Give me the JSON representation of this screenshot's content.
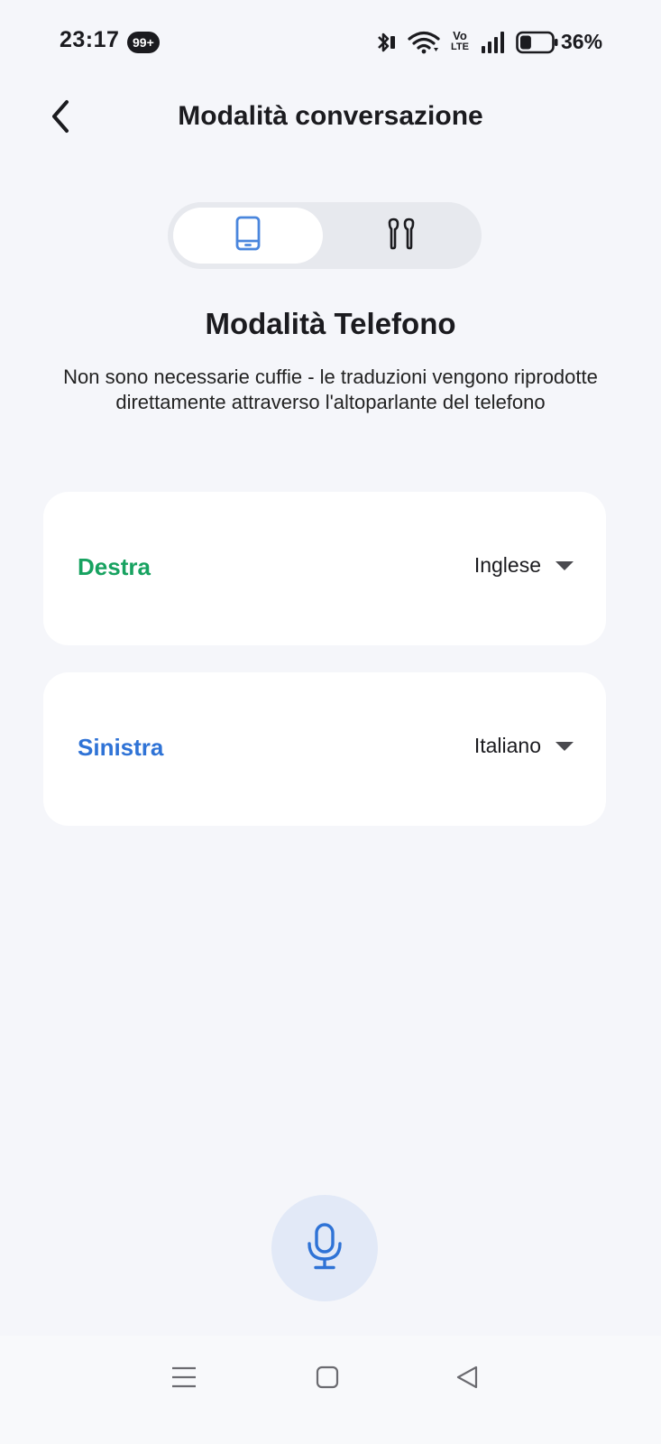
{
  "status_bar": {
    "time": "23:17",
    "notification_badge": "99+",
    "icons": [
      "bluetooth-icon",
      "wifi-icon",
      "volte-icon",
      "signal-icon",
      "battery-icon"
    ],
    "volte_top": "Vo",
    "volte_bottom": "LTE",
    "battery_percent": "36%",
    "battery_level": 0.36
  },
  "header": {
    "title": "Modalità conversazione",
    "back_icon": "chevron-left-icon"
  },
  "mode_switch": {
    "options": [
      {
        "icon": "phone-icon",
        "selected": true
      },
      {
        "icon": "earbuds-icon",
        "selected": false
      }
    ]
  },
  "mode": {
    "title": "Modalità Telefono",
    "description": "Non sono necessarie cuffie - le traduzioni vengono riprodotte direttamente attraverso l'altoparlante del telefono"
  },
  "speakers": [
    {
      "label": "Destra",
      "language": "Inglese",
      "color": "#17a260"
    },
    {
      "label": "Sinistra",
      "language": "Italiano",
      "color": "#2f73d6"
    }
  ],
  "mic": {
    "icon": "microphone-icon",
    "accent": "#2f73d6",
    "background": "#e2e9f7"
  },
  "nav_bar": {
    "buttons": [
      "menu-icon",
      "home-icon",
      "back-triangle-icon"
    ]
  }
}
